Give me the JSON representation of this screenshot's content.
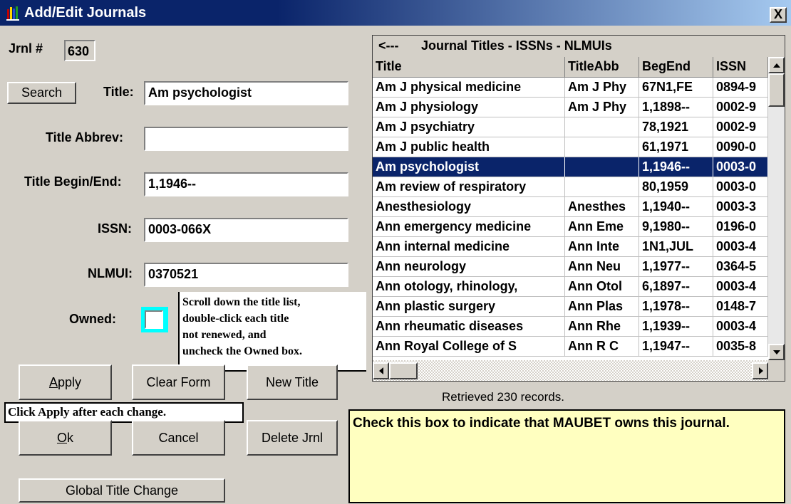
{
  "window": {
    "title": "Add/Edit Journals",
    "close_glyph": "X"
  },
  "form": {
    "jrnl_label": "Jrnl #",
    "jrnl_value": "630",
    "search_label": "Search",
    "title_label": "Title:",
    "title_value": "Am psychologist",
    "title_abbrev_label": "Title Abbrev:",
    "title_abbrev_value": "",
    "begin_end_label": "Title Begin/End:",
    "begin_end_value": "1,1946--",
    "issn_label": "ISSN:",
    "issn_value": "0003-066X",
    "nlmui_label": "NLMUI:",
    "nlmui_value": "0370521",
    "owned_label": "Owned:",
    "owned_checked": false
  },
  "buttons": {
    "apply": "Apply",
    "clear_form": "Clear Form",
    "new_title": "New Title",
    "ok": "Ok",
    "cancel": "Cancel",
    "delete_jrnl": "Delete Jrnl",
    "global_title_change": "Global Title Change"
  },
  "notes": {
    "scroll_note": [
      "Scroll down the title list,",
      "double-click each title",
      "not renewed, and",
      "uncheck the Owned box."
    ],
    "apply_note": "Click Apply after each change."
  },
  "grid": {
    "caption_arrow": "<---",
    "caption": "Journal Titles - ISSNs - NLMUIs",
    "columns": [
      "Title",
      "TitleAbb",
      "BegEnd",
      "ISSN"
    ],
    "rows": [
      [
        "Am J physical medicine",
        "Am J Phy",
        "67N1,FE",
        "0894-9"
      ],
      [
        "Am J physiology",
        "Am J Phy",
        "1,1898--",
        "0002-9"
      ],
      [
        "Am J psychiatry",
        "",
        "78,1921",
        "0002-9"
      ],
      [
        "Am J public health",
        "",
        "61,1971",
        "0090-0"
      ],
      [
        "Am psychologist",
        "",
        "1,1946--",
        "0003-0"
      ],
      [
        "Am review of respiratory",
        "",
        "80,1959",
        "0003-0"
      ],
      [
        "Anesthesiology",
        "Anesthes",
        "1,1940--",
        "0003-3"
      ],
      [
        "Ann emergency medicine",
        "Ann Eme",
        "9,1980--",
        "0196-0"
      ],
      [
        "Ann internal medicine",
        "Ann Inte",
        "1N1,JUL",
        "0003-4"
      ],
      [
        "Ann neurology",
        "Ann Neu",
        "1,1977--",
        "0364-5"
      ],
      [
        "Ann otology, rhinology,",
        "Ann Otol",
        "6,1897--",
        "0003-4"
      ],
      [
        "Ann plastic surgery",
        "Ann Plas",
        "1,1978--",
        "0148-7"
      ],
      [
        "Ann rheumatic diseases",
        "Ann Rhe",
        "1,1939--",
        "0003-4"
      ],
      [
        "Ann Royal College of S",
        "Ann R C",
        "1,1947--",
        "0035-8"
      ]
    ],
    "selected_row": 4
  },
  "status_text": "Retrieved 230 records.",
  "help_text": "Check this box to indicate that MAUBET owns this journal.",
  "colors": {
    "titlebar": "#0a246a",
    "selection": "#0a246a",
    "face": "#d4d0c8",
    "help_bg": "#ffffc0",
    "focus": "#00ffff"
  }
}
